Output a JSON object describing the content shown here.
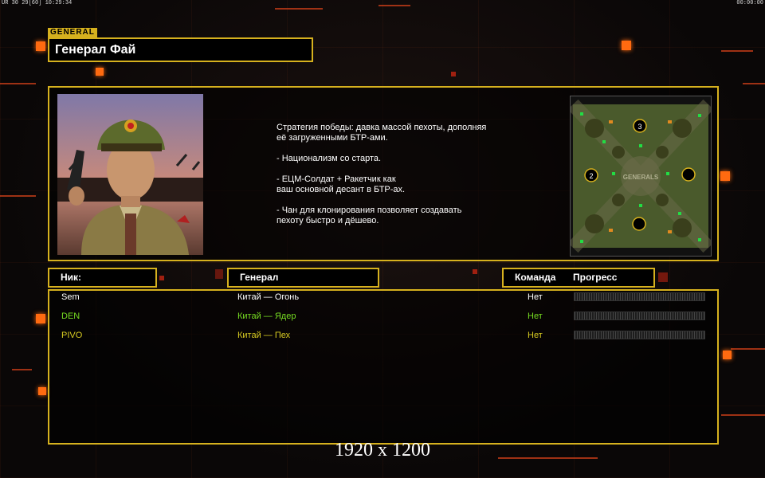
{
  "status_bar": {
    "left": "UR 30 29[60] 10:29:34",
    "right": "00:00:00"
  },
  "general": {
    "tag": "GENERAL",
    "name": "Генерал Фай",
    "portrait_icon": "general-portrait",
    "description": "Стратегия победы: давка массой пехоты, дополняя\n её загруженными БТР-ами.\n\n- Национализм со старта.\n\n- ЕЦМ-Солдат + Ракетчик как\nваш основной десант в БТР-ах.\n\n- Чан для клонирования позволяет создавать\n пехоту быстро и дёшево."
  },
  "map": {
    "icon": "minimap",
    "start_labels": [
      "3",
      "2"
    ]
  },
  "columns": {
    "nick": "Ник:",
    "general": "Генерал",
    "team": "Команда",
    "progress": "Прогресс"
  },
  "players": [
    {
      "nick": "Sem",
      "general": "Китай — Огонь",
      "team": "Нет",
      "color": "#ffffff",
      "progress": 0
    },
    {
      "nick": "DEN",
      "general": "Китай — Ядер",
      "team": "Нет",
      "color": "#77dd22",
      "progress": 0
    },
    {
      "nick": "PIVO",
      "general": "Китай — Пех",
      "team": "Нет",
      "color": "#d8cc22",
      "progress": 0
    }
  ],
  "resolution_label": "1920 x 1200",
  "colors": {
    "accent": "#d6b11e",
    "orange": "#ff6a10"
  }
}
